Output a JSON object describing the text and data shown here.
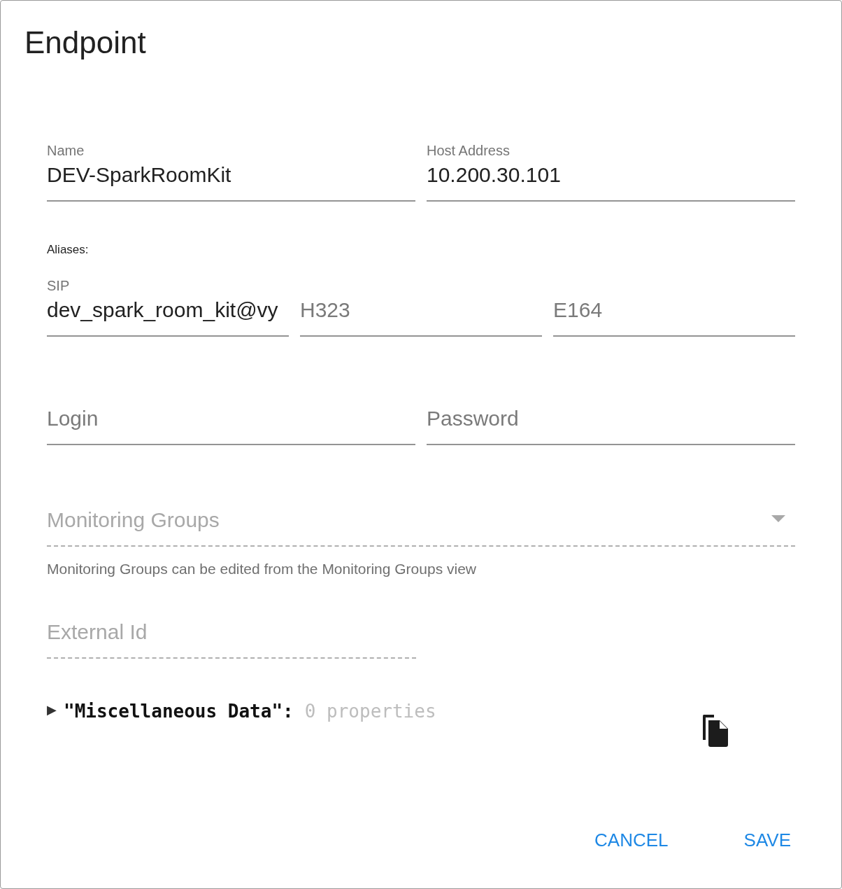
{
  "dialog": {
    "title": "Endpoint"
  },
  "row_1": [
    {
      "label": "Name",
      "value": "DEV-SparkRoomKit",
      "disabled": false
    },
    {
      "label": "Host Address",
      "value": "10.200.30.101",
      "disabled": false
    }
  ],
  "aliases_heading": "Aliases:",
  "aliases": [
    {
      "label": "SIP",
      "value": "dev_spark_room_kit@vy",
      "disabled": false
    },
    {
      "placeholder": "H323",
      "disabled": false
    },
    {
      "placeholder": "E164",
      "disabled": false
    }
  ],
  "credentials": [
    {
      "placeholder": "Login",
      "disabled": false
    },
    {
      "placeholder": "Password",
      "disabled": false
    }
  ],
  "monitoring_groups": {
    "placeholder": "Monitoring Groups",
    "disabled": true,
    "helper": "Monitoring Groups can be edited from the Monitoring Groups view"
  },
  "external_id": {
    "placeholder": "External Id",
    "disabled": true
  },
  "misc_data": {
    "toggle": "▶",
    "key": "\"Miscellaneous Data\":",
    "count": "0 properties",
    "expanded": false
  },
  "buttons": [
    "CANCEL",
    "SAVE"
  ]
}
